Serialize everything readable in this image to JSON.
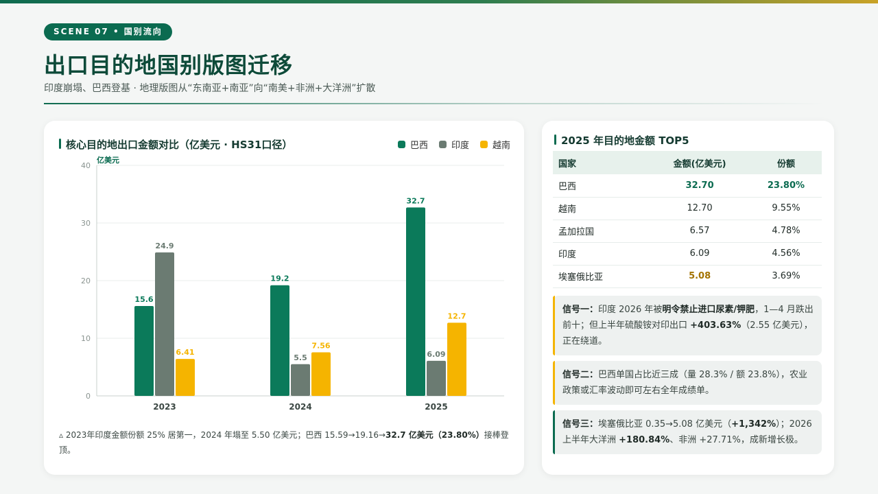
{
  "header": {
    "scene_label": "SCENE 07 • 国别流向",
    "title": "出口目的地国别版图迁移",
    "subtitle": "印度崩塌、巴西登基 · 地理版图从“东南亚+南亚”向“南美+非洲+大洋洲”扩散"
  },
  "colors": {
    "brazil": "#0b7a5a",
    "india": "#6b7b72",
    "vietnam": "#f5b400",
    "accent": "#0b6b50"
  },
  "chart_panel": {
    "title": "核心目的地出口金额对比（亿美元 · HS31口径）",
    "legend": [
      "巴西",
      "印度",
      "越南"
    ],
    "footnote_prefix": "▵ 2023年印度金额份额 25% 居第一，2024 年塌至 5.50 亿美元；巴西 15.59→19.16→",
    "footnote_bold": "32.7 亿美元（23.80%）",
    "footnote_suffix": "接棒登顶。"
  },
  "chart_data": {
    "type": "bar",
    "categories": [
      "2023",
      "2024",
      "2025"
    ],
    "ylabel": "亿美元",
    "ylim": [
      0,
      40
    ],
    "yticks": [
      0,
      10,
      20,
      30,
      40
    ],
    "grid": true,
    "legend_position": "top-right",
    "series": [
      {
        "name": "巴西",
        "values": [
          15.6,
          19.2,
          32.7
        ],
        "labels": [
          "15.6",
          "19.2",
          "32.7"
        ],
        "color": "#0b7a5a"
      },
      {
        "name": "印度",
        "values": [
          24.9,
          5.5,
          6.09
        ],
        "labels": [
          "24.9",
          "5.5",
          "6.09"
        ],
        "color": "#6b7b72"
      },
      {
        "name": "越南",
        "values": [
          6.41,
          7.56,
          12.7
        ],
        "labels": [
          "6.41",
          "7.56",
          "12.7"
        ],
        "color": "#f5b400"
      }
    ]
  },
  "top5": {
    "title": "2025 年目的地金额 TOP5",
    "columns": [
      "国家",
      "金额(亿美元)",
      "份额"
    ],
    "rows": [
      {
        "country": "巴西",
        "amount": "32.70",
        "share": "23.80%"
      },
      {
        "country": "越南",
        "amount": "12.70",
        "share": "9.55%"
      },
      {
        "country": "孟加拉国",
        "amount": "6.57",
        "share": "4.78%"
      },
      {
        "country": "印度",
        "amount": "6.09",
        "share": "4.56%"
      },
      {
        "country": "埃塞俄比亚",
        "amount": "5.08",
        "share": "3.69%"
      }
    ]
  },
  "signals": [
    {
      "label": "信号一：",
      "t1": "印度 2026 年被",
      "b1": "明令禁止进口尿素/钾肥",
      "t2": "，1—4 月跌出前十；但上半年硫酸铵对印出口 ",
      "b2": "+403.63%",
      "t3": "（2.55 亿美元），正在绕道。"
    },
    {
      "label": "信号二：",
      "t1": "巴西单国占比近三成（量 28.3% / 额 23.8%），农业政策或汇率波动即可左右全年成绩单。"
    },
    {
      "label": "信号三：",
      "t1": "埃塞俄比亚 0.35→5.08 亿美元（",
      "b1": "+1,342%",
      "t2": "）；2026 上半年大洋洲 ",
      "b2": "+180.84%",
      "t3": "、非洲 +27.71%，成新增长极。"
    }
  ]
}
